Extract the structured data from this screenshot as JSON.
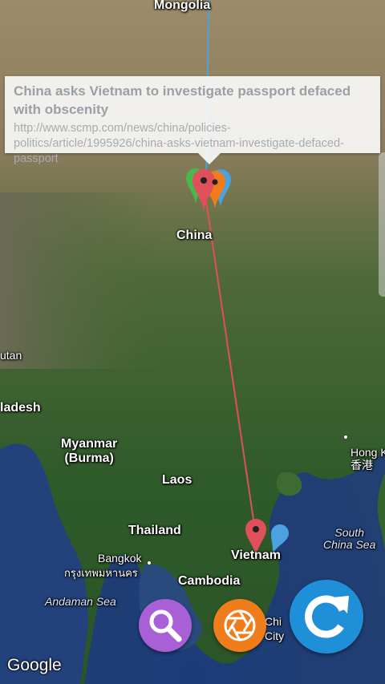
{
  "map": {
    "place_labels": {
      "mongolia": "Mongolia",
      "china": "China",
      "bhutan_partial": "utan",
      "bangladesh_partial": "ladesh",
      "myanmar": "Myanmar\n(Burma)",
      "laos": "Laos",
      "thailand": "Thailand",
      "bangkok": "Bangkok",
      "bangkok_native": "กรุงเทพมหานคร",
      "cambodia": "Cambodia",
      "vietnam": "Vietnam",
      "hong_kong": "Hong K",
      "hong_kong_native": "香港",
      "south_china_sea": "South\nChina Sea",
      "andaman_sea": "Andaman Sea",
      "ho_chi_minh_partial_1": "Chi",
      "ho_chi_minh_partial_2": "City"
    },
    "attribution": "Google",
    "route_colors": {
      "red": "#e0505a",
      "blue": "#4aa3df"
    }
  },
  "info_card": {
    "title": "China asks Vietnam to investigate passport defaced with obscenity",
    "url": "http://www.scmp.com/news/china/policies-politics/article/1995926/china-asks-vietnam-investigate-defaced-passport"
  },
  "actions": {
    "search_icon": "search-icon",
    "camera_icon": "aperture-icon",
    "refresh_icon": "refresh-icon",
    "colors": {
      "search": "#a95fd6",
      "camera": "#f07d1c",
      "refresh": "#1f8fd8"
    }
  }
}
